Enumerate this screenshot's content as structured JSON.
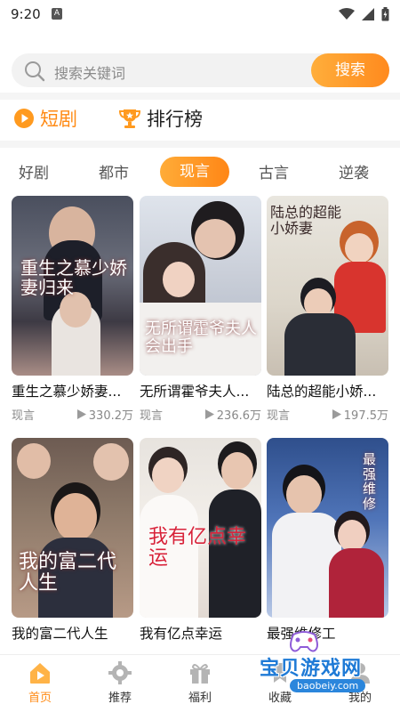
{
  "status_bar": {
    "time": "9:20",
    "sim_glyph": "A"
  },
  "search": {
    "placeholder": "搜索关键词",
    "button_label": "搜索"
  },
  "quick_nav": [
    {
      "label": "短剧",
      "icon": "play-circle-icon"
    },
    {
      "label": "排行榜",
      "icon": "trophy-icon"
    }
  ],
  "tabs": [
    {
      "label": "好剧",
      "active": false
    },
    {
      "label": "都市",
      "active": false
    },
    {
      "label": "现言",
      "active": true
    },
    {
      "label": "古言",
      "active": false
    },
    {
      "label": "逆袭",
      "active": false
    }
  ],
  "cards": [
    {
      "title": "重生之慕少娇妻...",
      "poster_text": "重生之慕少娇妻归来",
      "genre": "现言",
      "plays": "330.2万"
    },
    {
      "title": "无所谓霍爷夫人...",
      "poster_text": "无所谓霍爷夫人会出手",
      "genre": "现言",
      "plays": "236.6万"
    },
    {
      "title": "陆总的超能小娇...",
      "poster_text": "陆总的超能小娇妻",
      "genre": "现言",
      "plays": "197.5万"
    },
    {
      "title": "我的富二代人生",
      "poster_text": "我的富二代人生",
      "genre": "",
      "plays": ""
    },
    {
      "title": "我有亿点幸运",
      "poster_text": "我有亿点幸运",
      "genre": "",
      "plays": ""
    },
    {
      "title": "最强维修工",
      "poster_text": "最强维修工",
      "genre": "",
      "plays": ""
    }
  ],
  "bottom_nav": [
    {
      "label": "首页",
      "icon": "home-play-icon",
      "active": true
    },
    {
      "label": "推荐",
      "icon": "gear-icon",
      "active": false
    },
    {
      "label": "福利",
      "icon": "gift-icon",
      "active": false
    },
    {
      "label": "收藏",
      "icon": "bookmark-icon",
      "active": false
    },
    {
      "label": "我的",
      "icon": "user-icon",
      "active": false
    }
  ],
  "watermark": {
    "title": "宝贝游戏网",
    "url": "baobeiy.com"
  },
  "colors": {
    "accent": "#ff8a14",
    "accent_light": "#ffae3b",
    "text": "#222222",
    "muted": "#888888"
  }
}
